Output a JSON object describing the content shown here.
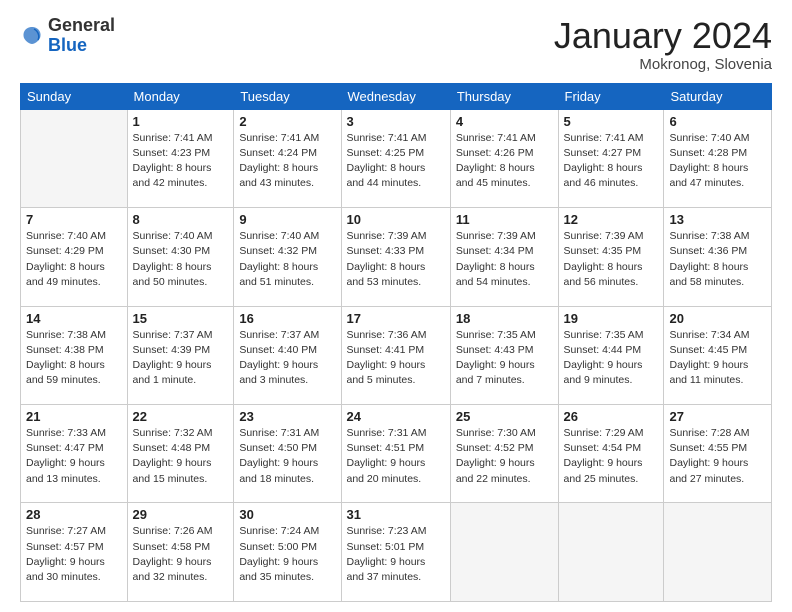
{
  "logo": {
    "general": "General",
    "blue": "Blue"
  },
  "header": {
    "month": "January 2024",
    "location": "Mokronog, Slovenia"
  },
  "weekdays": [
    "Sunday",
    "Monday",
    "Tuesday",
    "Wednesday",
    "Thursday",
    "Friday",
    "Saturday"
  ],
  "weeks": [
    [
      {
        "day": "",
        "empty": true
      },
      {
        "day": "1",
        "sunrise": "Sunrise: 7:41 AM",
        "sunset": "Sunset: 4:23 PM",
        "daylight": "Daylight: 8 hours and 42 minutes."
      },
      {
        "day": "2",
        "sunrise": "Sunrise: 7:41 AM",
        "sunset": "Sunset: 4:24 PM",
        "daylight": "Daylight: 8 hours and 43 minutes."
      },
      {
        "day": "3",
        "sunrise": "Sunrise: 7:41 AM",
        "sunset": "Sunset: 4:25 PM",
        "daylight": "Daylight: 8 hours and 44 minutes."
      },
      {
        "day": "4",
        "sunrise": "Sunrise: 7:41 AM",
        "sunset": "Sunset: 4:26 PM",
        "daylight": "Daylight: 8 hours and 45 minutes."
      },
      {
        "day": "5",
        "sunrise": "Sunrise: 7:41 AM",
        "sunset": "Sunset: 4:27 PM",
        "daylight": "Daylight: 8 hours and 46 minutes."
      },
      {
        "day": "6",
        "sunrise": "Sunrise: 7:40 AM",
        "sunset": "Sunset: 4:28 PM",
        "daylight": "Daylight: 8 hours and 47 minutes."
      }
    ],
    [
      {
        "day": "7",
        "sunrise": "Sunrise: 7:40 AM",
        "sunset": "Sunset: 4:29 PM",
        "daylight": "Daylight: 8 hours and 49 minutes."
      },
      {
        "day": "8",
        "sunrise": "Sunrise: 7:40 AM",
        "sunset": "Sunset: 4:30 PM",
        "daylight": "Daylight: 8 hours and 50 minutes."
      },
      {
        "day": "9",
        "sunrise": "Sunrise: 7:40 AM",
        "sunset": "Sunset: 4:32 PM",
        "daylight": "Daylight: 8 hours and 51 minutes."
      },
      {
        "day": "10",
        "sunrise": "Sunrise: 7:39 AM",
        "sunset": "Sunset: 4:33 PM",
        "daylight": "Daylight: 8 hours and 53 minutes."
      },
      {
        "day": "11",
        "sunrise": "Sunrise: 7:39 AM",
        "sunset": "Sunset: 4:34 PM",
        "daylight": "Daylight: 8 hours and 54 minutes."
      },
      {
        "day": "12",
        "sunrise": "Sunrise: 7:39 AM",
        "sunset": "Sunset: 4:35 PM",
        "daylight": "Daylight: 8 hours and 56 minutes."
      },
      {
        "day": "13",
        "sunrise": "Sunrise: 7:38 AM",
        "sunset": "Sunset: 4:36 PM",
        "daylight": "Daylight: 8 hours and 58 minutes."
      }
    ],
    [
      {
        "day": "14",
        "sunrise": "Sunrise: 7:38 AM",
        "sunset": "Sunset: 4:38 PM",
        "daylight": "Daylight: 8 hours and 59 minutes."
      },
      {
        "day": "15",
        "sunrise": "Sunrise: 7:37 AM",
        "sunset": "Sunset: 4:39 PM",
        "daylight": "Daylight: 9 hours and 1 minute."
      },
      {
        "day": "16",
        "sunrise": "Sunrise: 7:37 AM",
        "sunset": "Sunset: 4:40 PM",
        "daylight": "Daylight: 9 hours and 3 minutes."
      },
      {
        "day": "17",
        "sunrise": "Sunrise: 7:36 AM",
        "sunset": "Sunset: 4:41 PM",
        "daylight": "Daylight: 9 hours and 5 minutes."
      },
      {
        "day": "18",
        "sunrise": "Sunrise: 7:35 AM",
        "sunset": "Sunset: 4:43 PM",
        "daylight": "Daylight: 9 hours and 7 minutes."
      },
      {
        "day": "19",
        "sunrise": "Sunrise: 7:35 AM",
        "sunset": "Sunset: 4:44 PM",
        "daylight": "Daylight: 9 hours and 9 minutes."
      },
      {
        "day": "20",
        "sunrise": "Sunrise: 7:34 AM",
        "sunset": "Sunset: 4:45 PM",
        "daylight": "Daylight: 9 hours and 11 minutes."
      }
    ],
    [
      {
        "day": "21",
        "sunrise": "Sunrise: 7:33 AM",
        "sunset": "Sunset: 4:47 PM",
        "daylight": "Daylight: 9 hours and 13 minutes."
      },
      {
        "day": "22",
        "sunrise": "Sunrise: 7:32 AM",
        "sunset": "Sunset: 4:48 PM",
        "daylight": "Daylight: 9 hours and 15 minutes."
      },
      {
        "day": "23",
        "sunrise": "Sunrise: 7:31 AM",
        "sunset": "Sunset: 4:50 PM",
        "daylight": "Daylight: 9 hours and 18 minutes."
      },
      {
        "day": "24",
        "sunrise": "Sunrise: 7:31 AM",
        "sunset": "Sunset: 4:51 PM",
        "daylight": "Daylight: 9 hours and 20 minutes."
      },
      {
        "day": "25",
        "sunrise": "Sunrise: 7:30 AM",
        "sunset": "Sunset: 4:52 PM",
        "daylight": "Daylight: 9 hours and 22 minutes."
      },
      {
        "day": "26",
        "sunrise": "Sunrise: 7:29 AM",
        "sunset": "Sunset: 4:54 PM",
        "daylight": "Daylight: 9 hours and 25 minutes."
      },
      {
        "day": "27",
        "sunrise": "Sunrise: 7:28 AM",
        "sunset": "Sunset: 4:55 PM",
        "daylight": "Daylight: 9 hours and 27 minutes."
      }
    ],
    [
      {
        "day": "28",
        "sunrise": "Sunrise: 7:27 AM",
        "sunset": "Sunset: 4:57 PM",
        "daylight": "Daylight: 9 hours and 30 minutes."
      },
      {
        "day": "29",
        "sunrise": "Sunrise: 7:26 AM",
        "sunset": "Sunset: 4:58 PM",
        "daylight": "Daylight: 9 hours and 32 minutes."
      },
      {
        "day": "30",
        "sunrise": "Sunrise: 7:24 AM",
        "sunset": "Sunset: 5:00 PM",
        "daylight": "Daylight: 9 hours and 35 minutes."
      },
      {
        "day": "31",
        "sunrise": "Sunrise: 7:23 AM",
        "sunset": "Sunset: 5:01 PM",
        "daylight": "Daylight: 9 hours and 37 minutes."
      },
      {
        "day": "",
        "empty": true
      },
      {
        "day": "",
        "empty": true
      },
      {
        "day": "",
        "empty": true
      }
    ]
  ]
}
